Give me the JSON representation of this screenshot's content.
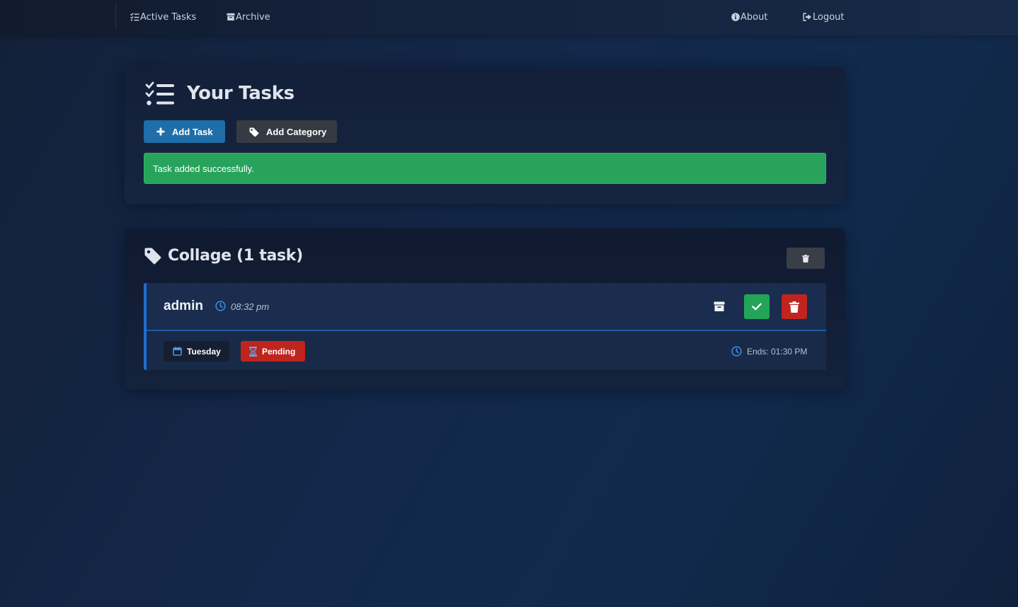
{
  "nav": {
    "active_tasks": "Active Tasks",
    "archive": "Archive",
    "about": "About",
    "logout": "Logout"
  },
  "header": {
    "title": "Your Tasks",
    "add_task_label": "Add Task",
    "add_category_label": "Add Category",
    "alert_message": "Task added successfully."
  },
  "category": {
    "title": "Collage (1 task)",
    "tasks": [
      {
        "name": "admin",
        "time": "08:32 pm",
        "day": "Tuesday",
        "status": "Pending",
        "ends": "Ends: 01:30 PM"
      }
    ]
  },
  "colors": {
    "primary_button": "#1f6ea9",
    "secondary_button": "#363b43",
    "success": "#27a35b",
    "danger": "#c0241e",
    "accent_border": "#1e6fd0"
  },
  "icons": {
    "active_tasks": "list-check-icon",
    "archive": "archive-box-icon",
    "about": "info-circle-icon",
    "logout": "logout-icon",
    "title": "list-check-icon",
    "add_task": "plus-icon",
    "add_category": "tag-icon",
    "category": "tag-icon",
    "category_delete": "trash-icon",
    "task_time": "clock-icon",
    "task_archive": "archive-box-icon",
    "task_done": "check-icon",
    "task_delete": "trash-icon",
    "day": "calendar-icon",
    "status": "hourglass-icon",
    "ends": "clock-icon"
  }
}
